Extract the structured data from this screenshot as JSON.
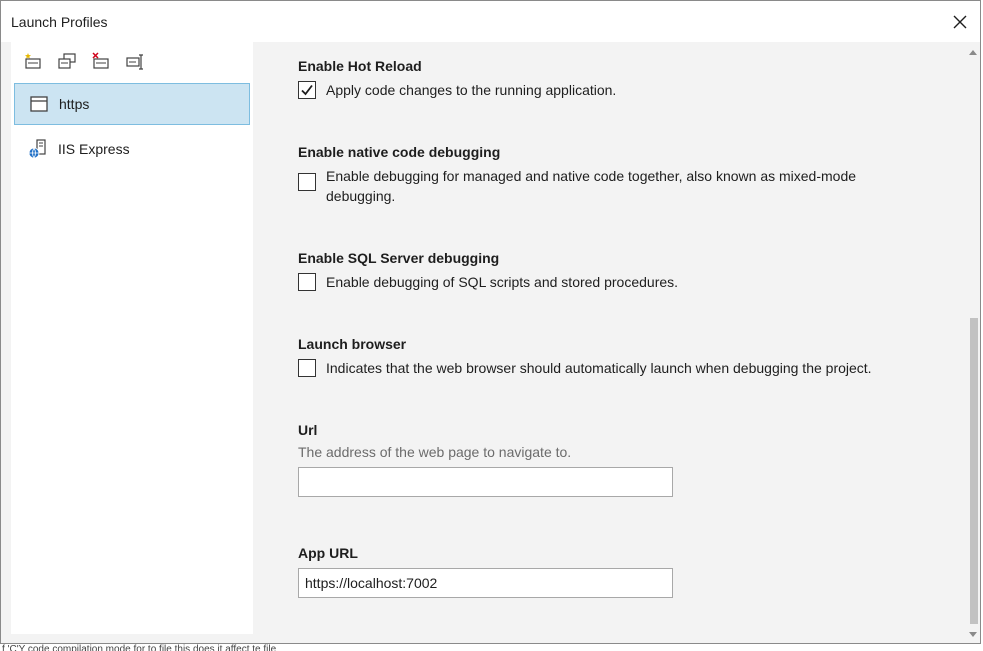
{
  "window": {
    "title": "Launch Profiles",
    "close_icon": "close-icon"
  },
  "toolbar": {
    "buttons": [
      {
        "name": "new-profile-icon"
      },
      {
        "name": "copy-profile-icon"
      },
      {
        "name": "delete-profile-icon"
      },
      {
        "name": "rename-profile-icon"
      }
    ]
  },
  "profiles": [
    {
      "label": "https",
      "icon": "window-icon",
      "selected": true
    },
    {
      "label": "IIS Express",
      "icon": "iis-server-icon",
      "selected": false
    }
  ],
  "settings": {
    "hot_reload": {
      "title": "Enable Hot Reload",
      "label": "Apply code changes to the running application.",
      "checked": true
    },
    "native_debug": {
      "title": "Enable native code debugging",
      "label": "Enable debugging for managed and native code together, also known as mixed-mode debugging.",
      "checked": false
    },
    "sql_debug": {
      "title": "Enable SQL Server debugging",
      "label": "Enable debugging of SQL scripts and stored procedures.",
      "checked": false
    },
    "launch_browser": {
      "title": "Launch browser",
      "label": "Indicates that the web browser should automatically launch when debugging the project.",
      "checked": false
    },
    "url": {
      "title": "Url",
      "hint": "The address of the web page to navigate to.",
      "value": ""
    },
    "app_url": {
      "title": "App URL",
      "value": "https://localhost:7002"
    }
  },
  "background_text": "f 'C'Y code compilation mode for to file this does it affect te file",
  "colors": {
    "selection_bg": "#cce4f2",
    "selection_border": "#7dbde0",
    "pane_bg": "#f3f3f3"
  }
}
